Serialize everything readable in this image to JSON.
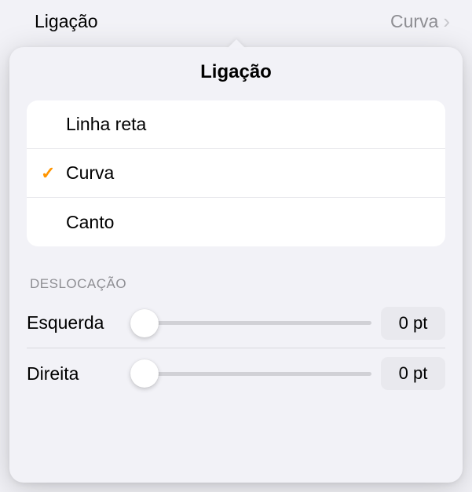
{
  "header": {
    "label": "Ligação",
    "value": "Curva"
  },
  "popover": {
    "title": "Ligação",
    "options": [
      {
        "label": "Linha reta",
        "selected": false
      },
      {
        "label": "Curva",
        "selected": true
      },
      {
        "label": "Canto",
        "selected": false
      }
    ],
    "offset": {
      "section_label": "DESLOCAÇÃO",
      "rows": [
        {
          "label": "Esquerda",
          "value": "0 pt",
          "position": 0
        },
        {
          "label": "Direita",
          "value": "0 pt",
          "position": 0
        }
      ]
    }
  }
}
